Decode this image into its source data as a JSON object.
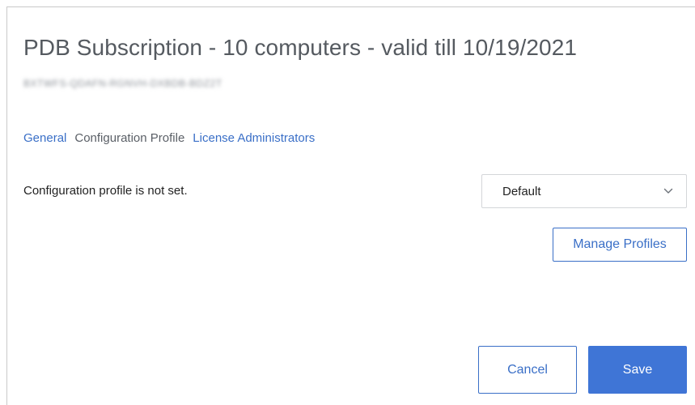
{
  "dialog": {
    "title": "PDB Subscription - 10 computers - valid till 10/19/2021",
    "license_key": "BXTWFS-QDAFN-RGNVH-DXBDB-BDZ2T"
  },
  "tabs": [
    {
      "label": "General",
      "active": false
    },
    {
      "label": "Configuration Profile",
      "active": true
    },
    {
      "label": "License Administrators",
      "active": false
    }
  ],
  "config": {
    "status_text": "Configuration profile is not set.",
    "profile_select": {
      "selected": "Default",
      "icon": "chevron-down-icon"
    },
    "manage_profiles_label": "Manage Profiles"
  },
  "footer": {
    "cancel_label": "Cancel",
    "save_label": "Save"
  },
  "colors": {
    "link": "#3a6fc7",
    "primary": "#3f75d6",
    "title": "#555a60"
  }
}
